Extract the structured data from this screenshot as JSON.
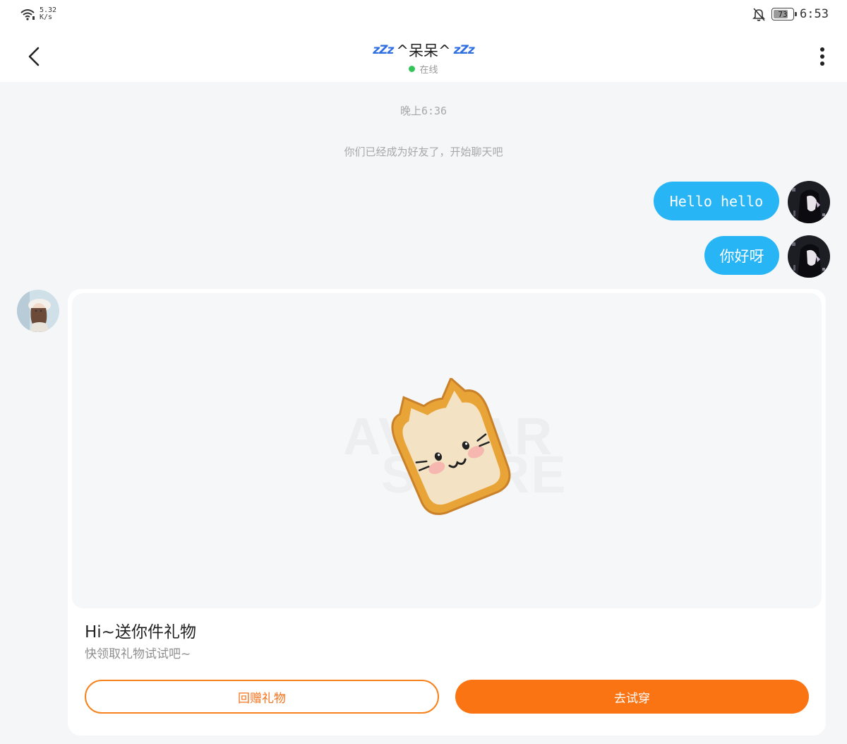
{
  "status_bar": {
    "net_speed_value": "5.32",
    "net_speed_unit": "K/s",
    "battery": "73",
    "time": "6:53",
    "icons": [
      "wifi-icon",
      "bell-off-icon",
      "battery-icon"
    ]
  },
  "header": {
    "left_decoration": "zZz",
    "title": "^呆呆^",
    "right_decoration": "zZz",
    "status": "在线"
  },
  "chat": {
    "timestamp": "晚上6:36",
    "system_notice": "你们已经成为好友了，开始聊天吧",
    "messages": [
      {
        "from": "me",
        "text": "Hello hello"
      },
      {
        "from": "me",
        "text": "你好呀"
      }
    ]
  },
  "gift_card": {
    "title": "Hi~送你件礼物",
    "subtitle": "快领取礼物试试吧~",
    "return_label": "回赠礼物",
    "try_label": "去试穿",
    "watermark_line1": "AVATAR",
    "watermark_line2": "STORE"
  },
  "colors": {
    "bubble": "#27b5f6",
    "accent": "#fb7414",
    "online": "#33c45a"
  }
}
